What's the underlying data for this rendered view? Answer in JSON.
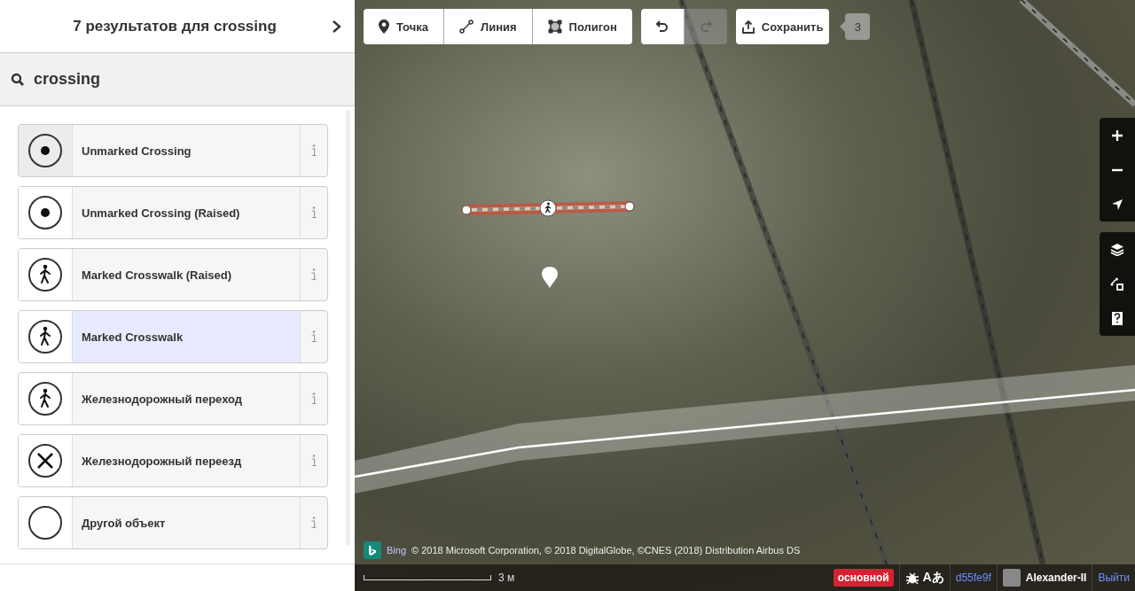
{
  "sidebar": {
    "title": "7 результатов для crossing",
    "search": {
      "value": "crossing"
    },
    "presets": [
      {
        "name": "Unmarked Crossing",
        "kind": "dot",
        "selected": false,
        "focused": true
      },
      {
        "name": "Unmarked Crossing (Raised)",
        "kind": "dot",
        "selected": false,
        "focused": false
      },
      {
        "name": "Marked Crosswalk (Raised)",
        "kind": "walker",
        "selected": false,
        "focused": false
      },
      {
        "name": "Marked Crosswalk",
        "kind": "walker",
        "selected": true,
        "focused": false
      },
      {
        "name": "Железнодорожный переход",
        "kind": "walker",
        "selected": false,
        "focused": false
      },
      {
        "name": "Железнодорожный переезд",
        "kind": "cross",
        "selected": false,
        "focused": false
      },
      {
        "name": "Другой объект",
        "kind": "empty",
        "selected": false,
        "focused": false
      }
    ]
  },
  "toolbar": {
    "modes": [
      {
        "label": "Точка",
        "kind": "point"
      },
      {
        "label": "Линия",
        "kind": "line"
      },
      {
        "label": "Полигон",
        "kind": "area"
      }
    ],
    "undo": {
      "disabled": false
    },
    "redo": {
      "disabled": true
    },
    "save": {
      "label": "Сохранить",
      "count": "3"
    }
  },
  "map": {
    "attribution": {
      "provider": "Bing",
      "text": "© 2018 Microsoft Corporation, © 2018 DigitalGlobe, ©CNES (2018) Distribution Airbus DS"
    },
    "scale": "3 м",
    "footer": {
      "branch_badge": "основной",
      "language": "Aあ",
      "version": "d55fe9f",
      "user": "Alexander-II",
      "logout": "Выйти"
    }
  }
}
